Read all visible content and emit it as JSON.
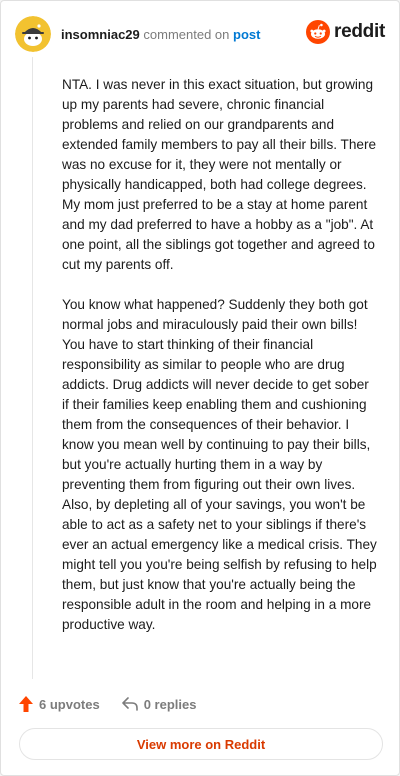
{
  "header": {
    "username": "insomniac29",
    "action_text": "commented on",
    "link_text": "post",
    "brand": "reddit"
  },
  "comment": {
    "paragraphs": [
      "NTA. I was never in this exact situation, but growing up my parents had severe, chronic financial problems and relied on our grandparents and extended family members to pay all their bills. There was no excuse for it, they were not mentally or physically handicapped, both had college degrees. My mom just preferred to be a stay at home parent and my dad preferred to have a hobby as a \"job\". At one point, all the siblings got together and agreed to cut my parents off.",
      "You know what happened? Suddenly they both got normal jobs and miraculously paid their own bills! You have to start thinking of their financial responsibility as similar to people who are drug addicts. Drug addicts will never decide to get sober if their families keep enabling them and cushioning them from the consequences of their behavior. I know you mean well by continuing to pay their bills, but you're actually hurting them in a way by preventing them from figuring out their own lives. Also, by depleting all of your savings, you won't be able to act as a safety net to your siblings if there's ever an actual emergency like a medical crisis. They might tell you you're being selfish by refusing to help them, but just know that you're actually being the responsible adult in the room and helping in a more productive way."
    ]
  },
  "actions": {
    "upvotes": "6 upvotes",
    "replies": "0 replies"
  },
  "footer": {
    "view_more": "View more on Reddit"
  },
  "colors": {
    "brand": "#ff4500",
    "link": "#0079d3",
    "view_more": "#d93a00",
    "avatar": "#f2c230"
  },
  "icons": {
    "avatar": "snoo-avatar",
    "logo": "reddit-snoo-icon",
    "upvote": "upvote-arrow-icon",
    "reply": "reply-arrow-icon"
  }
}
